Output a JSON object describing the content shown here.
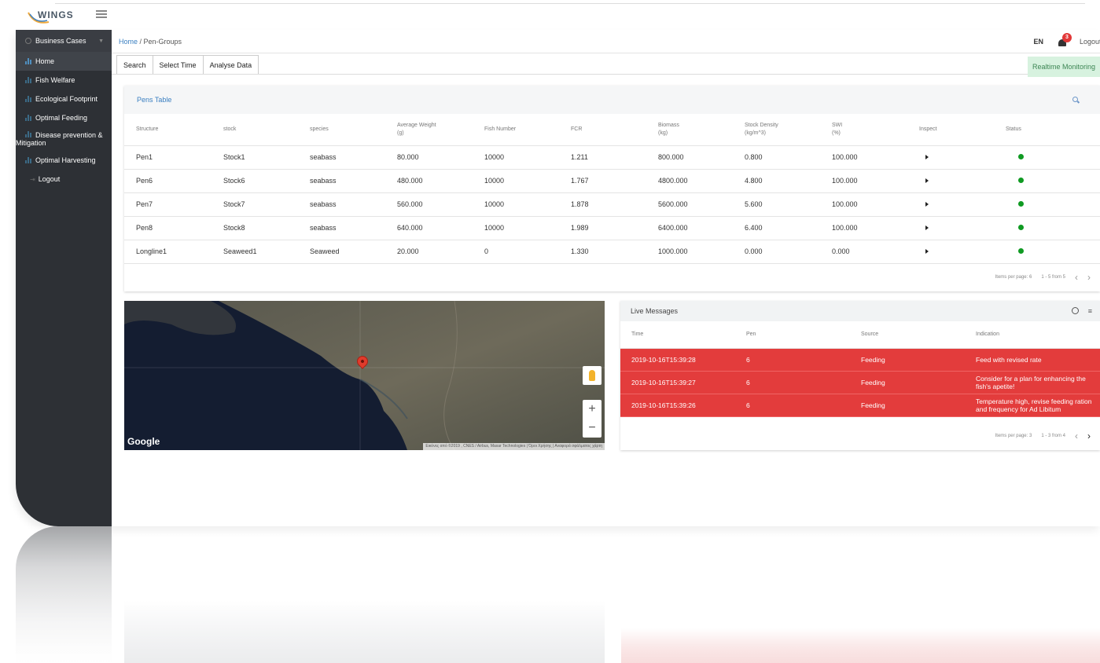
{
  "brand": {
    "logo_text": "WINGS"
  },
  "header": {
    "breadcrumb_home": "Home",
    "breadcrumb_sep": " / ",
    "breadcrumb_current": "Pen-Groups",
    "lang": "EN",
    "notifications_count": "3",
    "logout_label": "Logout"
  },
  "sidebar": {
    "header": "Business Cases",
    "items": [
      {
        "label": "Home",
        "active": true
      },
      {
        "label": "Fish Welfare"
      },
      {
        "label": "Ecological Footprint"
      },
      {
        "label": "Optimal Feeding"
      },
      {
        "label": "Disease prevention & Mitigation"
      },
      {
        "label": "Optimal Harvesting"
      }
    ],
    "logout": "Logout"
  },
  "toolbar": {
    "search": "Search",
    "select_time": "Select Time",
    "analyse": "Analyse Data",
    "realtime": "Realtime Monitoring"
  },
  "pens_table": {
    "title": "Pens Table",
    "columns": [
      "Structure",
      "stock",
      "species",
      "Average Weight",
      "Fish Number",
      "FCR",
      "Biomass",
      "Stock Density",
      "SWI",
      "Inspect",
      "Status"
    ],
    "column_units": [
      "",
      "",
      "",
      "(g)",
      "",
      "",
      "(kg)",
      "(kg/m^3)",
      "(%)",
      "",
      ""
    ],
    "rows": [
      [
        "Pen1",
        "Stock1",
        "seabass",
        "80.000",
        "10000",
        "1.211",
        "800.000",
        "0.800",
        "100.000"
      ],
      [
        "Pen6",
        "Stock6",
        "seabass",
        "480.000",
        "10000",
        "1.767",
        "4800.000",
        "4.800",
        "100.000"
      ],
      [
        "Pen7",
        "Stock7",
        "seabass",
        "560.000",
        "10000",
        "1.878",
        "5600.000",
        "5.600",
        "100.000"
      ],
      [
        "Pen8",
        "Stock8",
        "seabass",
        "640.000",
        "10000",
        "1.989",
        "6400.000",
        "6.400",
        "100.000"
      ],
      [
        "Longline1",
        "Seaweed1",
        "Seaweed",
        "20.000",
        "0",
        "1.330",
        "1000.000",
        "0.000",
        "0.000"
      ]
    ],
    "items_per_page": "Items per page: 6",
    "range": "1 - 5 from 5"
  },
  "map": {
    "google_label": "Google",
    "attribution": "Εικόνες από ©2019 , CNES / Airbus, Maxar Technologies | Όροι Χρήσης | Αναφορά σφάλματος χάρτη",
    "zoom_in": "+",
    "zoom_out": "−"
  },
  "live_messages": {
    "title": "Live Messages",
    "columns": [
      "Time",
      "Pen",
      "Source",
      "Indication"
    ],
    "rows": [
      [
        "2019-10-16T15:39:28",
        "6",
        "Feeding",
        "Feed with revised rate"
      ],
      [
        "2019-10-16T15:39:27",
        "6",
        "Feeding",
        "Consider for a plan for enhancing the fish's apetite!"
      ],
      [
        "2019-10-16T15:39:26",
        "6",
        "Feeding",
        "Temperature high, revise feeding ration and frequency for Ad Libitum"
      ]
    ],
    "items_per_page": "Items per page: 3",
    "range": "1 - 3 from 4"
  },
  "colors": {
    "alert_red": "#e33c3c",
    "status_green": "#0f9a22",
    "link_blue": "#3a7fc1",
    "sidebar_bg": "#2d3035",
    "realtime_bg": "#d7f2df"
  }
}
